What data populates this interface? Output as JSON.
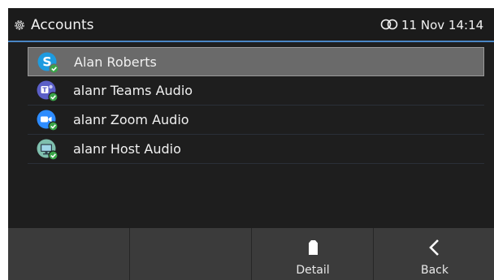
{
  "header": {
    "title": "Accounts",
    "date": "11 Nov",
    "time": "14:14",
    "accent_color": "#4a86c5"
  },
  "accounts": [
    {
      "label": "Alan Roberts",
      "icon": "skype-icon",
      "status": "registered",
      "selected": true
    },
    {
      "label": "alanr Teams Audio",
      "icon": "teams-icon",
      "status": "registered",
      "selected": false
    },
    {
      "label": "alanr Zoom Audio",
      "icon": "zoom-icon",
      "status": "registered",
      "selected": false
    },
    {
      "label": "alanr Host Audio",
      "icon": "host-monitor-icon",
      "status": "registered",
      "selected": false
    }
  ],
  "softkeys": [
    {
      "label": "",
      "icon": ""
    },
    {
      "label": "",
      "icon": ""
    },
    {
      "label": "Detail",
      "icon": "document-icon"
    },
    {
      "label": "Back",
      "icon": "chevron-left-icon"
    }
  ]
}
